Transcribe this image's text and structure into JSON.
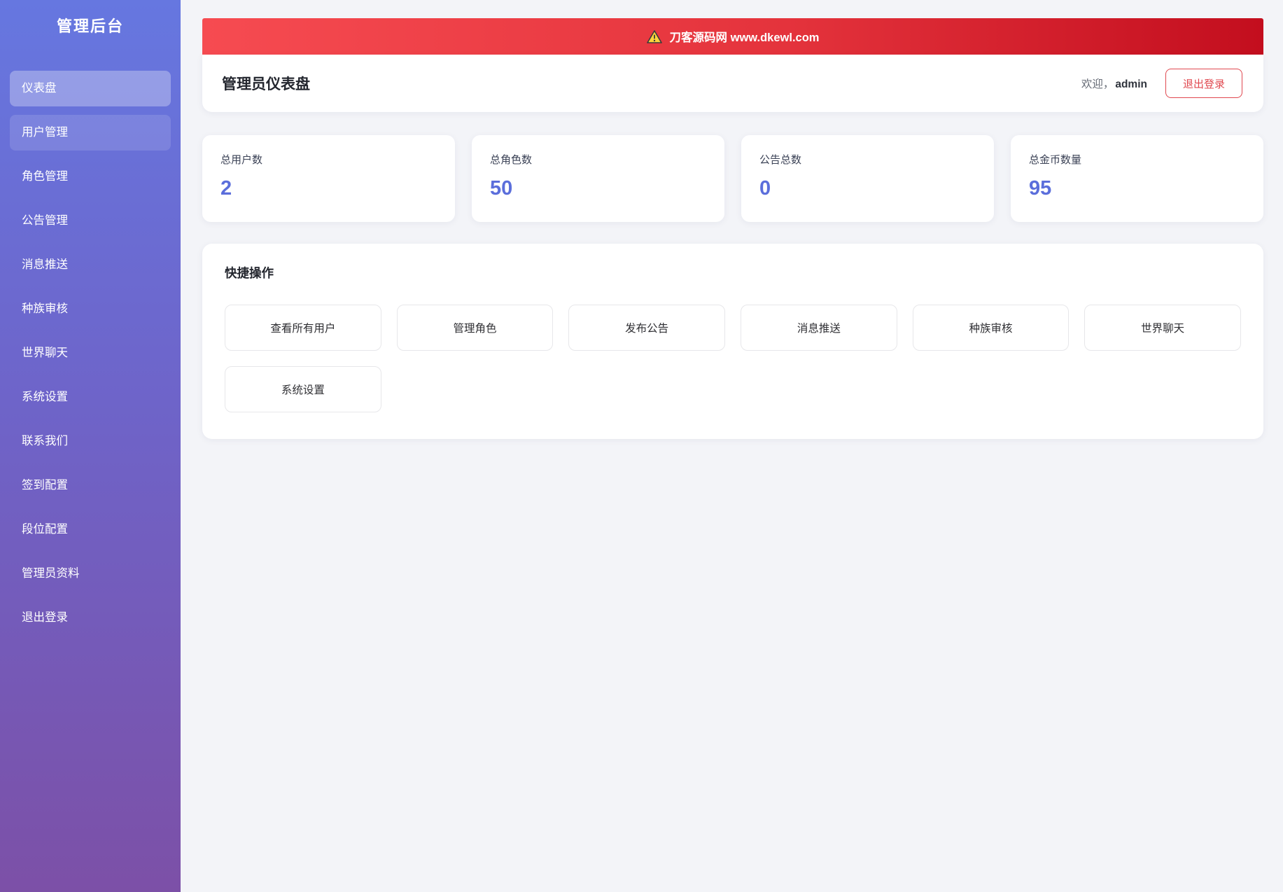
{
  "sidebar": {
    "title": "管理后台",
    "items": [
      {
        "label": "仪表盘",
        "state": "active"
      },
      {
        "label": "用户管理",
        "state": "highlight"
      },
      {
        "label": "角色管理",
        "state": "normal"
      },
      {
        "label": "公告管理",
        "state": "normal"
      },
      {
        "label": "消息推送",
        "state": "normal"
      },
      {
        "label": "种族审核",
        "state": "normal"
      },
      {
        "label": "世界聊天",
        "state": "normal"
      },
      {
        "label": "系统设置",
        "state": "normal"
      },
      {
        "label": "联系我们",
        "state": "normal"
      },
      {
        "label": "签到配置",
        "state": "normal"
      },
      {
        "label": "段位配置",
        "state": "normal"
      },
      {
        "label": "管理员资料",
        "state": "normal"
      },
      {
        "label": "退出登录",
        "state": "normal"
      }
    ]
  },
  "banner": {
    "icon": "warning-triangle-icon",
    "text": "刀客源码网 www.dkewl.com"
  },
  "header": {
    "title": "管理员仪表盘",
    "welcome_prefix": "欢迎，",
    "username": "admin",
    "logout_label": "退出登录"
  },
  "stats": [
    {
      "label": "总用户数",
      "value": "2"
    },
    {
      "label": "总角色数",
      "value": "50"
    },
    {
      "label": "公告总数",
      "value": "0"
    },
    {
      "label": "总金币数量",
      "value": "95"
    }
  ],
  "quick_actions": {
    "title": "快捷操作",
    "buttons": [
      "查看所有用户",
      "管理角色",
      "发布公告",
      "消息推送",
      "种族审核",
      "世界聊天",
      "系统设置"
    ]
  },
  "colors": {
    "sidebar_gradient_top": "#6677e0",
    "sidebar_gradient_bottom": "#7c50a7",
    "banner_red_left": "#f64b51",
    "banner_red_right": "#c30e1e",
    "stat_value_blue": "#5b6edb",
    "logout_red": "#e0484f",
    "page_background": "#f3f4f8",
    "warning_icon_yellow": "#ffd43b"
  }
}
